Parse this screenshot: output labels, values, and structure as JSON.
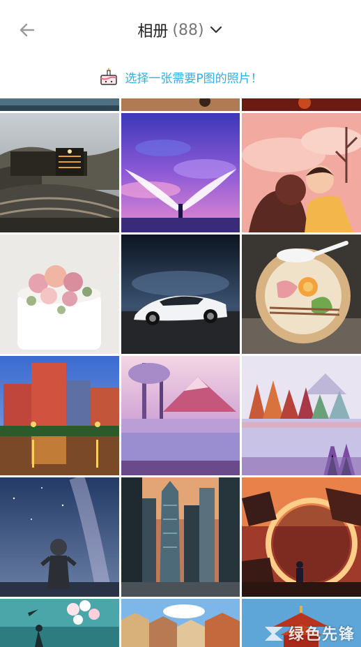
{
  "header": {
    "title": "相册",
    "count": "(88)"
  },
  "hint": {
    "text": "选择一张需要P图的照片！"
  },
  "watermark": {
    "text": "绿色先锋"
  },
  "photos": [
    {
      "name": "photo-partial-top-1"
    },
    {
      "name": "photo-partial-top-2"
    },
    {
      "name": "photo-partial-top-3"
    },
    {
      "name": "photo-train"
    },
    {
      "name": "photo-angel-wings"
    },
    {
      "name": "photo-couple-illustration"
    },
    {
      "name": "photo-flower-cake"
    },
    {
      "name": "photo-sports-car"
    },
    {
      "name": "photo-noodle-bowl"
    },
    {
      "name": "photo-city-reflection"
    },
    {
      "name": "photo-purple-mountain-painting"
    },
    {
      "name": "photo-watercolor-forest"
    },
    {
      "name": "photo-milky-way-statue"
    },
    {
      "name": "photo-skyscrapers"
    },
    {
      "name": "photo-red-planet-fantasy"
    },
    {
      "name": "photo-balloons"
    },
    {
      "name": "photo-european-houses"
    },
    {
      "name": "photo-chinese-pavilion"
    }
  ]
}
